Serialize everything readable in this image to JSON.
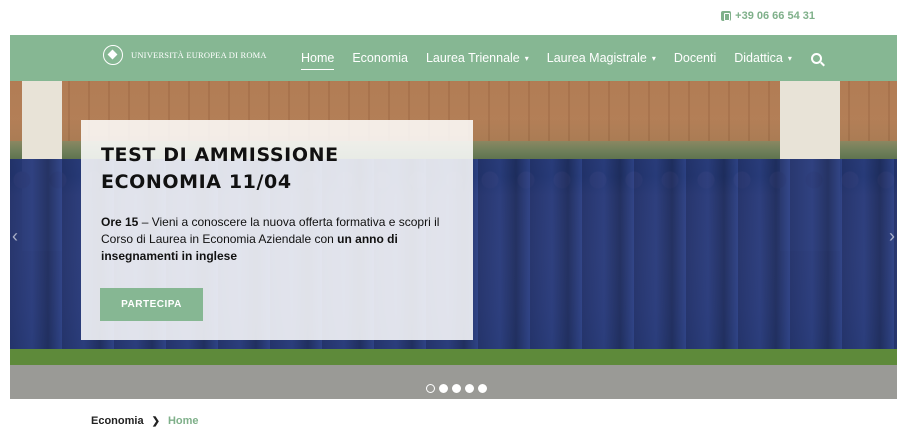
{
  "header": {
    "phone": "+39 06 66 54 31"
  },
  "nav": {
    "logo_text": "UNIVERSITÀ EUROPEA DI ROMA",
    "items": [
      {
        "label": "Home",
        "active": true,
        "dropdown": false
      },
      {
        "label": "Economia",
        "active": false,
        "dropdown": false
      },
      {
        "label": "Laurea Triennale",
        "active": false,
        "dropdown": true
      },
      {
        "label": "Laurea Magistrale",
        "active": false,
        "dropdown": true
      },
      {
        "label": "Docenti",
        "active": false,
        "dropdown": false
      },
      {
        "label": "Didattica",
        "active": false,
        "dropdown": true
      }
    ],
    "caret": "▾"
  },
  "hero": {
    "title": "TEST DI AMMISSIONE ECONOMIA 11/04",
    "text_strong_1": "Ore 15",
    "text_1": " – Vieni a conoscere la nuova offerta formativa e scopri il Corso di Laurea in Economia Aziendale con ",
    "text_strong_2": "un anno di insegnamenti in inglese",
    "cta_label": "PARTECIPA",
    "slides": 5,
    "active_slide": 0
  },
  "breadcrumb": {
    "parent": "Economia",
    "separator": "❯",
    "current": "Home"
  },
  "colors": {
    "accent": "#86b793",
    "accent_text": "#7fb08a"
  }
}
